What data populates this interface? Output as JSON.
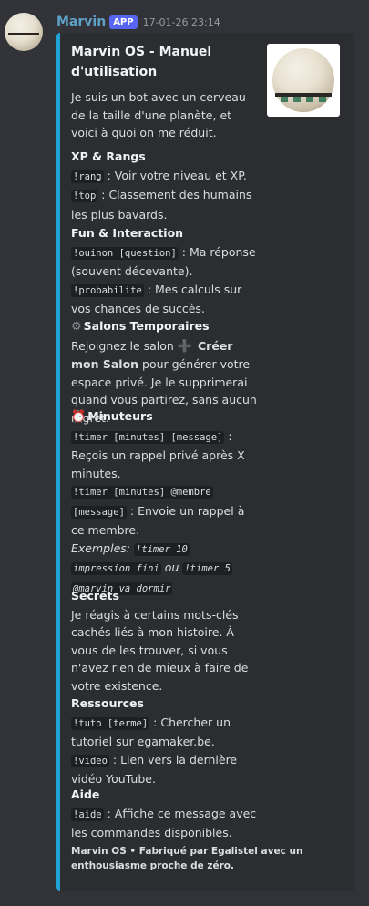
{
  "message": {
    "username": "Marvin",
    "badge": "APP",
    "timestamp": "17-01-26 23:14"
  },
  "embed": {
    "title": "Marvin OS - Manuel d'utilisation",
    "description": "Je suis un bot avec un cerveau de la taille d'une planète, et voici à quoi on me réduit.",
    "accent_color": "#20a4d6",
    "sections": {
      "xp": {
        "title": "XP & Rangs",
        "cmd_rang": "!rang",
        "txt_rang": " : Voir votre niveau et XP.",
        "cmd_top": "!top",
        "txt_top": " : Classement des humains les plus bavards."
      },
      "fun": {
        "title": "Fun & Interaction",
        "cmd_ouinon": "!ouinon [question]",
        "txt_ouinon": " : Ma réponse (souvent décevante).",
        "cmd_proba": "!probabilite",
        "txt_proba": " : Mes calculs sur vos chances de succès."
      },
      "salons": {
        "icon": "gear-icon",
        "title": "Salons Temporaires",
        "txt1": "Rejoignez le salon ",
        "icon2": "plus-icon",
        "bold": "Créer mon Salon",
        "txt2": " pour générer votre espace privé. Je le supprimerai quand vous partirez, sans aucun regret."
      },
      "timers": {
        "icon": "alarm-clock-icon",
        "title": "Minuteurs",
        "cmd1": "!timer [minutes] [message]",
        "txt1": " : Reçois un rappel privé après X minutes.",
        "cmd2a": "!timer [minutes] @membre",
        "cmd2b": "[message]",
        "txt2": " : Envoie un rappel à ce membre.",
        "ex_label": "Exemples: ",
        "ex1a": "!timer 10",
        "ex1b": "impression fini",
        "ex_or": " ou ",
        "ex2a": "!timer 5",
        "ex2b": "@marvin va dormir"
      },
      "secrets": {
        "title": "Secrets",
        "body": "Je réagis à certains mots-clés cachés liés à mon histoire. À vous de les trouver, si vous n'avez rien de mieux à faire de votre existence."
      },
      "ressources": {
        "title": "Ressources",
        "cmd_tuto": "!tuto [terme]",
        "txt_tuto": " : Chercher un tutoriel sur egamaker.be.",
        "cmd_video": "!video",
        "txt_video": " : Lien vers la dernière vidéo YouTube."
      },
      "aide": {
        "title": "Aide",
        "cmd": "!aide",
        "txt": " : Affiche ce message avec les commandes disponibles."
      }
    },
    "footer": "Marvin OS • Fabriqué par Egalistel avec un enthousiasme proche de zéro."
  }
}
